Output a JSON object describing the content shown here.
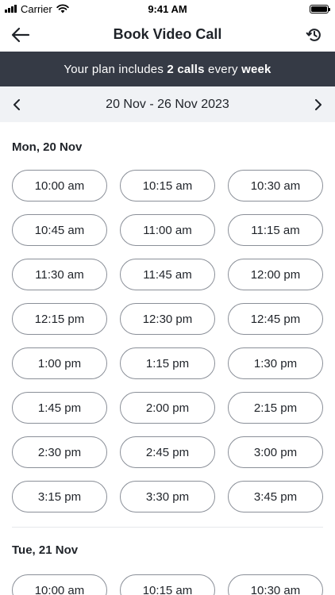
{
  "status_bar": {
    "carrier": "Carrier",
    "time": "9:41 AM"
  },
  "nav": {
    "title": "Book Video Call",
    "back_icon": "arrow-left-icon",
    "history_icon": "history-icon"
  },
  "banner": {
    "prefix": "Your plan includes ",
    "calls": "2 calls",
    "middle": " every ",
    "period": "week"
  },
  "week": {
    "range": "20 Nov - 26 Nov 2023"
  },
  "colors": {
    "banner_bg": "#353a45",
    "week_bar_bg": "#f0f2f5",
    "slot_border": "#8a8f98"
  },
  "days": [
    {
      "label": "Mon, 20 Nov",
      "slots": [
        "10:00 am",
        "10:15 am",
        "10:30 am",
        "10:45 am",
        "11:00 am",
        "11:15 am",
        "11:30 am",
        "11:45 am",
        "12:00 pm",
        "12:15 pm",
        "12:30 pm",
        "12:45 pm",
        "1:00 pm",
        "1:15 pm",
        "1:30 pm",
        "1:45 pm",
        "2:00 pm",
        "2:15 pm",
        "2:30 pm",
        "2:45 pm",
        "3:00 pm",
        "3:15 pm",
        "3:30 pm",
        "3:45 pm"
      ]
    },
    {
      "label": "Tue, 21 Nov",
      "slots": [
        "10:00 am",
        "10:15 am",
        "10:30 am"
      ]
    }
  ]
}
